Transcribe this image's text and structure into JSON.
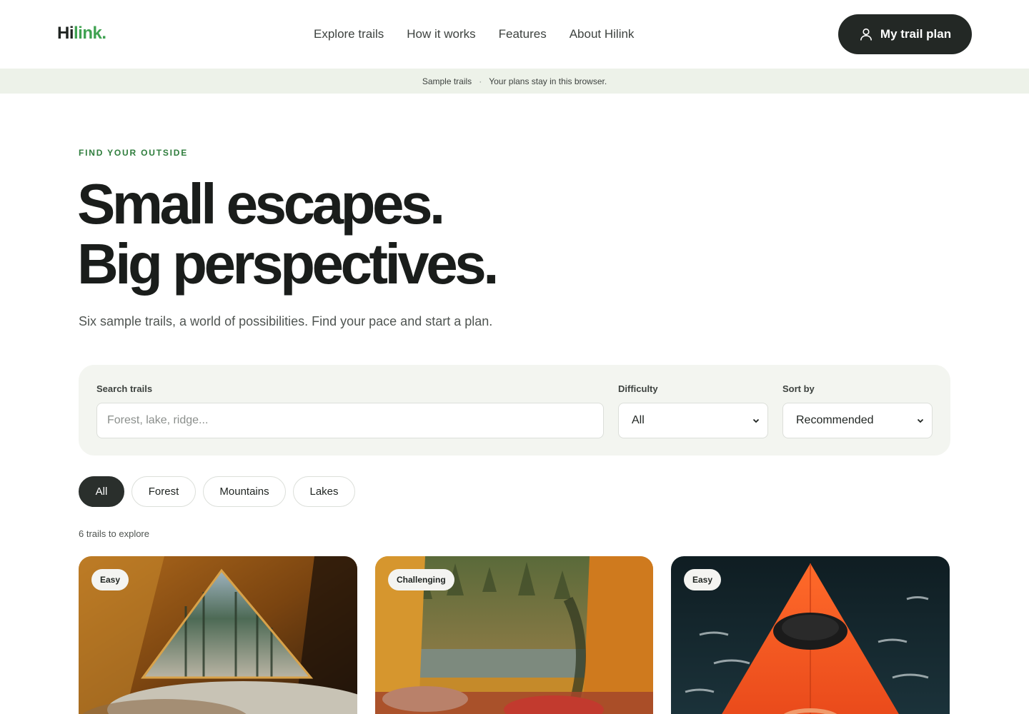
{
  "header": {
    "logo_prefix": "Hi",
    "logo_accent": "link.",
    "nav": [
      "Explore trails",
      "How it works",
      "Features",
      "About Hilink"
    ],
    "cta_label": "My trail plan",
    "cta_icon": "user-icon"
  },
  "notice": {
    "left": "Sample trails",
    "separator": "·",
    "right": "Your plans stay in this browser."
  },
  "hero": {
    "eyebrow": "FIND YOUR OUTSIDE",
    "headline_line1": "Small escapes.",
    "headline_line2": "Big perspectives.",
    "subtitle": "Six sample trails, a world of possibilities. Find your pace and start a plan."
  },
  "search": {
    "search_label": "Search trails",
    "search_placeholder": "Forest, lake, ridge...",
    "search_value": "",
    "difficulty_label": "Difficulty",
    "difficulty_value": "All",
    "sort_label": "Sort by",
    "sort_value": "Recommended"
  },
  "chips": [
    {
      "label": "All",
      "active": true
    },
    {
      "label": "Forest",
      "active": false
    },
    {
      "label": "Mountains",
      "active": false
    },
    {
      "label": "Lakes",
      "active": false
    }
  ],
  "results_count": "6 trails to explore",
  "cards": [
    {
      "difficulty": "Easy",
      "image": "tent-forest-view"
    },
    {
      "difficulty": "Challenging",
      "image": "tent-lake-view"
    },
    {
      "difficulty": "Easy",
      "image": "kayak-bow-on-water"
    }
  ],
  "colors": {
    "brand_accent": "#3fa251",
    "eyebrow": "#2f7d3d",
    "dark_button": "#232825",
    "notice_bg": "#edf2e9",
    "panel_bg": "#f3f5f0"
  }
}
